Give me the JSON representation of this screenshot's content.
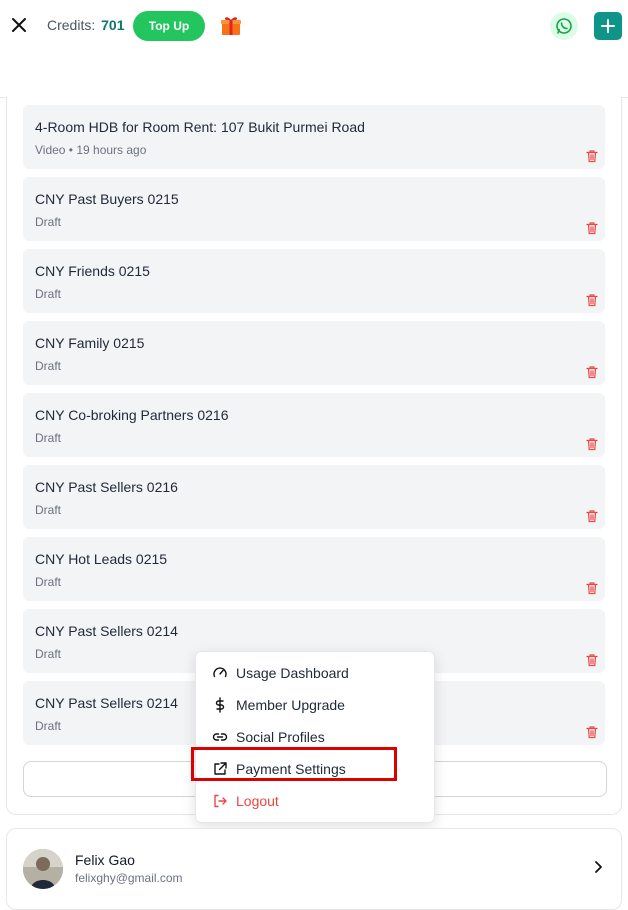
{
  "header": {
    "close_icon": "close-icon",
    "credits_label": "Credits:",
    "credits_value": "701",
    "topup_label": "Top Up",
    "gift_icon": "gift-icon",
    "whatsapp_icon": "whatsapp-icon",
    "add_icon": "plus-icon",
    "accent": "#22c55e",
    "brand": "#0f9488"
  },
  "items": [
    {
      "title": "4-Room HDB for Room Rent: 107 Bukit Purmei Road",
      "subtitle": "Video • 19 hours ago"
    },
    {
      "title": "CNY Past Buyers 0215",
      "subtitle": "Draft"
    },
    {
      "title": "CNY Friends 0215",
      "subtitle": "Draft"
    },
    {
      "title": "CNY Family 0215",
      "subtitle": "Draft"
    },
    {
      "title": "CNY Co-broking Partners 0216",
      "subtitle": "Draft"
    },
    {
      "title": "CNY Past Sellers 0216",
      "subtitle": "Draft"
    },
    {
      "title": "CNY Hot Leads 0215",
      "subtitle": "Draft"
    },
    {
      "title": "CNY Past Sellers 0214",
      "subtitle": "Draft"
    },
    {
      "title": "CNY Past Sellers 0214",
      "subtitle": "Draft"
    }
  ],
  "menu": {
    "usage": "Usage Dashboard",
    "upgrade": "Member Upgrade",
    "social": "Social Profiles",
    "payment": "Payment Settings",
    "logout": "Logout",
    "logout_color": "#ef4444"
  },
  "profile": {
    "name": "Felix Gao",
    "email": "felixghy@gmail.com"
  }
}
